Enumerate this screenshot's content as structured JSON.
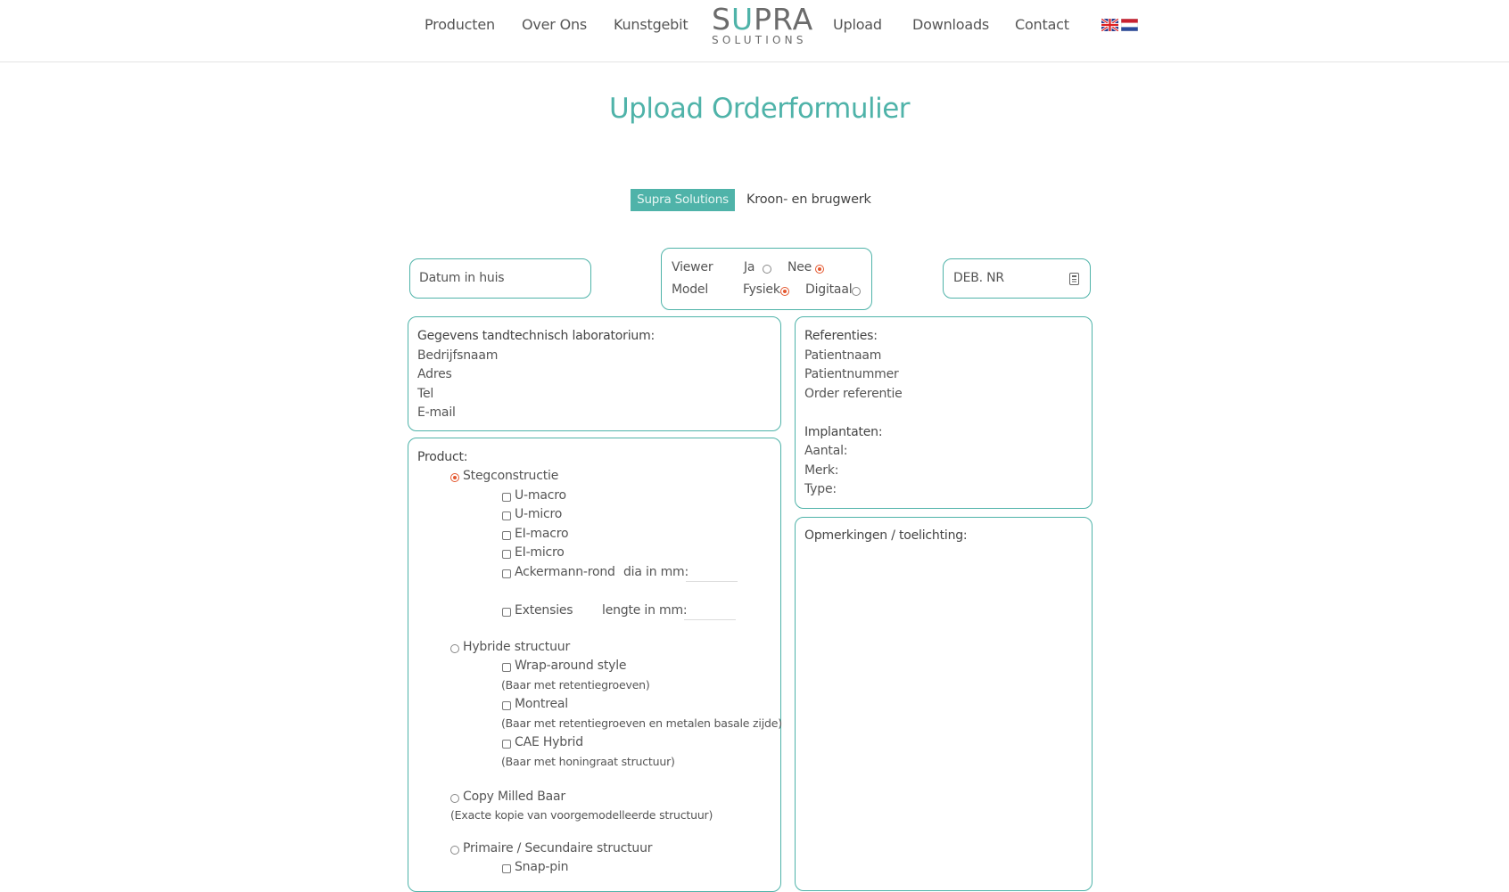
{
  "nav": {
    "items": [
      "Producten",
      "Over Ons",
      "Kunstgebit",
      "Upload",
      "Downloads",
      "Contact"
    ],
    "logo": {
      "main_left": "S",
      "main_u": "U",
      "main_right": "PRA",
      "sub": "SOLUTIONS"
    },
    "flags": [
      "flag-uk-icon",
      "flag-nl-icon"
    ]
  },
  "page": {
    "title": "Upload Orderformulier"
  },
  "tabs": {
    "active": "Supra Solutions",
    "other": "Kroon- en brugwerk"
  },
  "fields": {
    "datum": "Datum in huis",
    "deb_nr": "DEB. NR",
    "viewer_label": "Viewer",
    "viewer_ja": "Ja",
    "viewer_nee": "Nee",
    "model_label": "Model",
    "model_fysiek": "Fysiek",
    "model_digitaal": "Digitaal"
  },
  "lab": {
    "heading": "Gegevens tandtechnisch laboratorium:",
    "lines": [
      "Bedrijfsnaam",
      "Adres",
      "Tel",
      "E-mail"
    ]
  },
  "references": {
    "heading": "Referenties:",
    "lines": [
      "Patientnaam",
      "Patientnummer",
      "Order referentie"
    ],
    "implant_heading": "Implantaten:",
    "implant_lines": [
      "Aantal:",
      "Merk:",
      "Type:"
    ]
  },
  "remarks": {
    "heading": "Opmerkingen / toelichting:"
  },
  "product": {
    "heading": "Product:",
    "steg": "Stegconstructie",
    "steg_options": [
      "U-macro",
      "U-micro",
      "EI-macro",
      "EI-micro",
      "Ackermann-rond"
    ],
    "dia_label": "dia in mm:",
    "extensies": "Extensies",
    "lengte_label": "lengte in mm:",
    "hybride": "Hybride structuur",
    "wrap": "Wrap-around style",
    "wrap_note": "(Baar met retentiegroeven)",
    "montreal": "Montreal",
    "montreal_note": "(Baar met retentiegroeven en metalen basale zijde)",
    "cae": "CAE Hybrid",
    "cae_note": "(Baar met honingraat structuur)",
    "copy": "Copy Milled Baar",
    "copy_note": "(Exacte kopie van voorgemodelleerde structuur)",
    "primaire": "Primaire / Secundaire structuur",
    "snap": "Snap-pin"
  },
  "colors": {
    "accent": "#4fb3a9",
    "radio_selected": "#e4572e",
    "text": "#555555"
  }
}
